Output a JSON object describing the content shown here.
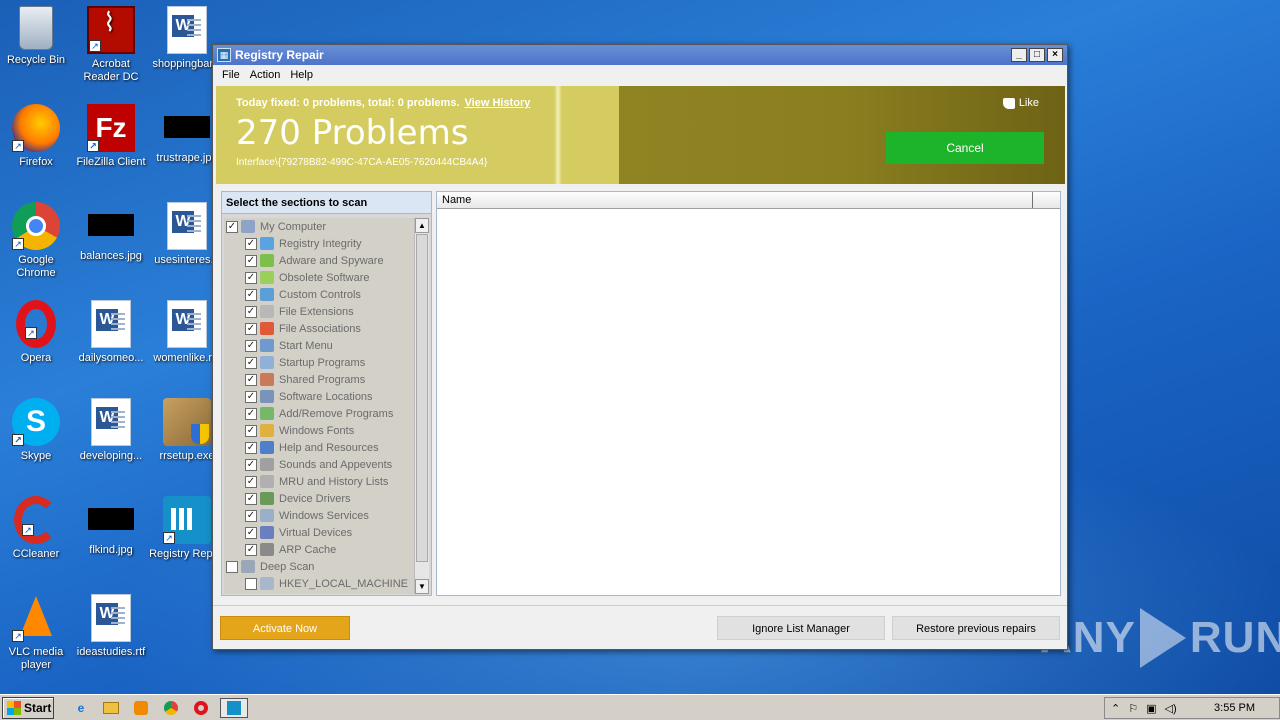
{
  "desktop": {
    "icons": [
      {
        "label": "Recycle Bin",
        "icon": "recycle-bin-icon"
      },
      {
        "label": "Acrobat Reader DC",
        "icon": "acrobat-icon"
      },
      {
        "label": "shoppingbar...",
        "icon": "word-doc-icon"
      },
      {
        "label": "Firefox",
        "icon": "firefox-icon"
      },
      {
        "label": "FileZilla Client",
        "icon": "filezilla-icon"
      },
      {
        "label": "trustrape.jpg",
        "icon": "image-thumb-icon"
      },
      {
        "label": "Google Chrome",
        "icon": "chrome-icon"
      },
      {
        "label": "balances.jpg",
        "icon": "image-thumb-icon"
      },
      {
        "label": "usesinteres...",
        "icon": "word-doc-icon"
      },
      {
        "label": "Opera",
        "icon": "opera-icon"
      },
      {
        "label": "dailysomeo...",
        "icon": "word-doc-icon"
      },
      {
        "label": "womenlike.r...",
        "icon": "word-doc-icon"
      },
      {
        "label": "Skype",
        "icon": "skype-icon"
      },
      {
        "label": "developing...",
        "icon": "word-doc-icon"
      },
      {
        "label": "rrsetup.exe",
        "icon": "installer-icon"
      },
      {
        "label": "CCleaner",
        "icon": "ccleaner-icon"
      },
      {
        "label": "flkind.jpg",
        "icon": "image-thumb-icon"
      },
      {
        "label": "Registry Repair",
        "icon": "registry-repair-icon"
      },
      {
        "label": "VLC media player",
        "icon": "vlc-icon"
      },
      {
        "label": "ideastudies.rtf",
        "icon": "word-doc-icon"
      }
    ]
  },
  "window": {
    "title": "Registry Repair",
    "menu": [
      "File",
      "Action",
      "Help"
    ],
    "controls": {
      "minimize": "_",
      "maximize": "□",
      "close": "×"
    }
  },
  "banner": {
    "fixed_text": "Today fixed: 0 problems, total: 0 problems.",
    "view_history": "View History",
    "problems": "270 Problems",
    "interface": "Interface\\{79278B82-499C-47CA-AE05-7620444CB4A4}",
    "like": "Like",
    "cancel": "Cancel",
    "colors": {
      "left": "#d4cc60",
      "right": "#8a7f1f",
      "cancel": "#1db42b"
    }
  },
  "sections": {
    "header": "Select the sections to scan",
    "items": [
      {
        "label": "My Computer",
        "checked": true,
        "level": 0,
        "icon": "computer-icon",
        "color": "#8fa3c9"
      },
      {
        "label": "Registry Integrity",
        "checked": true,
        "level": 1,
        "icon": "registry-icon",
        "color": "#5aa3e0"
      },
      {
        "label": "Adware and Spyware",
        "checked": true,
        "level": 1,
        "icon": "adware-icon",
        "color": "#7cc04b"
      },
      {
        "label": "Obsolete Software",
        "checked": true,
        "level": 1,
        "icon": "software-icon",
        "color": "#9bcf5b"
      },
      {
        "label": "Custom Controls",
        "checked": true,
        "level": 1,
        "icon": "controls-icon",
        "color": "#5b9fd6"
      },
      {
        "label": "File Extensions",
        "checked": true,
        "level": 1,
        "icon": "file-icon",
        "color": "#b8b8b8"
      },
      {
        "label": "File Associations",
        "checked": true,
        "level": 1,
        "icon": "association-icon",
        "color": "#e05a3a"
      },
      {
        "label": "Start Menu",
        "checked": true,
        "level": 1,
        "icon": "start-menu-icon",
        "color": "#6f9ad0"
      },
      {
        "label": "Startup Programs",
        "checked": true,
        "level": 1,
        "icon": "startup-icon",
        "color": "#8fb0d8"
      },
      {
        "label": "Shared Programs",
        "checked": true,
        "level": 1,
        "icon": "shared-icon",
        "color": "#c87a5a"
      },
      {
        "label": "Software Locations",
        "checked": true,
        "level": 1,
        "icon": "location-icon",
        "color": "#7a93b8"
      },
      {
        "label": "Add/Remove Programs",
        "checked": true,
        "level": 1,
        "icon": "add-remove-icon",
        "color": "#76b86a"
      },
      {
        "label": "Windows Fonts",
        "checked": true,
        "level": 1,
        "icon": "fonts-icon",
        "color": "#e0b040"
      },
      {
        "label": "Help and Resources",
        "checked": true,
        "level": 1,
        "icon": "help-icon",
        "color": "#4f7fc8"
      },
      {
        "label": "Sounds and Appevents",
        "checked": true,
        "level": 1,
        "icon": "sound-icon",
        "color": "#a0a0a0"
      },
      {
        "label": "MRU and History Lists",
        "checked": true,
        "level": 1,
        "icon": "history-icon",
        "color": "#b0b0b0"
      },
      {
        "label": "Device Drivers",
        "checked": true,
        "level": 1,
        "icon": "driver-icon",
        "color": "#6a9a5a"
      },
      {
        "label": "Windows Services",
        "checked": true,
        "level": 1,
        "icon": "services-icon",
        "color": "#9ab0c8"
      },
      {
        "label": "Virtual Devices",
        "checked": true,
        "level": 1,
        "icon": "virtual-icon",
        "color": "#6a7fc0"
      },
      {
        "label": "ARP Cache",
        "checked": true,
        "level": 1,
        "icon": "arp-icon",
        "color": "#8a8a8a"
      },
      {
        "label": "Deep Scan",
        "checked": false,
        "level": 0,
        "icon": "deep-scan-icon",
        "color": "#9aa7b8"
      },
      {
        "label": "HKEY_LOCAL_MACHINE",
        "checked": false,
        "level": 1,
        "icon": "hive-icon",
        "color": "#a8b8cc"
      }
    ]
  },
  "results": {
    "columns": [
      "Name"
    ]
  },
  "bottom": {
    "activate": "Activate Now",
    "ignore_list": "Ignore List Manager",
    "restore": "Restore previous repairs"
  },
  "taskbar": {
    "start": "Start",
    "apps": [
      "ie-icon",
      "explorer-icon",
      "media-player-icon",
      "chrome-icon",
      "opera-icon",
      "registry-repair-icon"
    ],
    "clock": "3:55 PM"
  },
  "watermark": {
    "text": "ANY",
    "text2": "RUN"
  }
}
